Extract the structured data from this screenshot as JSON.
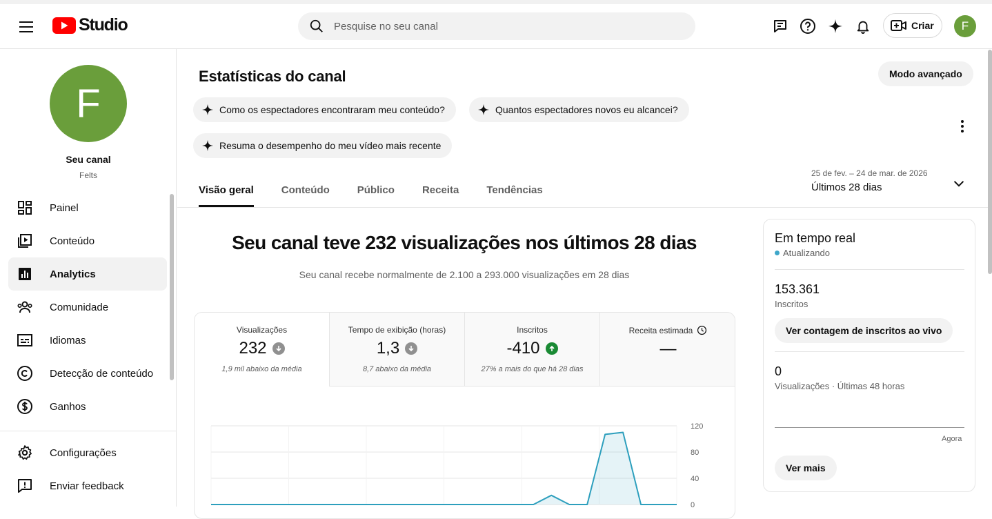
{
  "header": {
    "logo_text": "Studio",
    "search_placeholder": "Pesquise no seu canal",
    "create_label": "Criar",
    "avatar_letter": "F"
  },
  "sidebar": {
    "avatar_letter": "F",
    "channel_title": "Seu canal",
    "channel_handle": "Felts",
    "items": [
      {
        "label": "Painel",
        "icon": "dashboard-icon"
      },
      {
        "label": "Conteúdo",
        "icon": "content-icon"
      },
      {
        "label": "Analytics",
        "icon": "analytics-icon"
      },
      {
        "label": "Comunidade",
        "icon": "community-icon"
      },
      {
        "label": "Idiomas",
        "icon": "subtitles-icon"
      },
      {
        "label": "Detecção de conteúdo",
        "icon": "copyright-icon"
      },
      {
        "label": "Ganhos",
        "icon": "dollar-icon"
      }
    ],
    "footer_items": [
      {
        "label": "Configurações",
        "icon": "gear-icon"
      },
      {
        "label": "Enviar feedback",
        "icon": "feedback-icon"
      }
    ]
  },
  "main": {
    "title": "Estatísticas do canal",
    "advanced_mode": "Modo avançado",
    "chips": [
      "Como os espectadores encontraram meu conteúdo?",
      "Quantos espectadores novos eu alcancei?",
      "Resuma o desempenho do meu vídeo mais recente"
    ],
    "date_range_dates": "25 de fev. – 24 de mar. de 2026",
    "date_range_label": "Últimos 28 dias",
    "tabs": [
      "Visão geral",
      "Conteúdo",
      "Público",
      "Receita",
      "Tendências"
    ],
    "headline": "Seu canal teve 232 visualizações nos últimos 28 dias",
    "subline": "Seu canal recebe normalmente de 2.100 a 293.000 visualizações em 28 dias",
    "metrics": [
      {
        "label": "Visualizações",
        "value": "232",
        "note": "1,9 mil abaixo da média",
        "trend": "down"
      },
      {
        "label": "Tempo de exibição (horas)",
        "value": "1,3",
        "note": "8,7 abaixo da média",
        "trend": "down"
      },
      {
        "label": "Inscritos",
        "value": "-410",
        "note": "27% a mais do que há 28 dias",
        "trend": "up"
      },
      {
        "label": "Receita estimada",
        "value": "—",
        "note": "",
        "trend": "none"
      }
    ]
  },
  "chart_data": {
    "type": "area",
    "title": "",
    "xlabel": "",
    "ylabel": "",
    "ylim": [
      0,
      120
    ],
    "yticks": [
      "120",
      "80",
      "40",
      "0"
    ],
    "series": [
      {
        "color": "#2d9fbd",
        "values": [
          0,
          0,
          0,
          0,
          0,
          0,
          0,
          0,
          0,
          0,
          0,
          0,
          0,
          0,
          0,
          0,
          0,
          0,
          0,
          14,
          0,
          0,
          107,
          110,
          0,
          0,
          0
        ]
      }
    ]
  },
  "realtime": {
    "title": "Em tempo real",
    "status": "Atualizando",
    "subscribers_value": "153.361",
    "subscribers_label": "Inscritos",
    "live_count_button": "Ver contagem de inscritos ao vivo",
    "views_value": "0",
    "views_label": "Visualizações · Últimas 48 horas",
    "now_label": "Agora",
    "see_more": "Ver mais"
  }
}
